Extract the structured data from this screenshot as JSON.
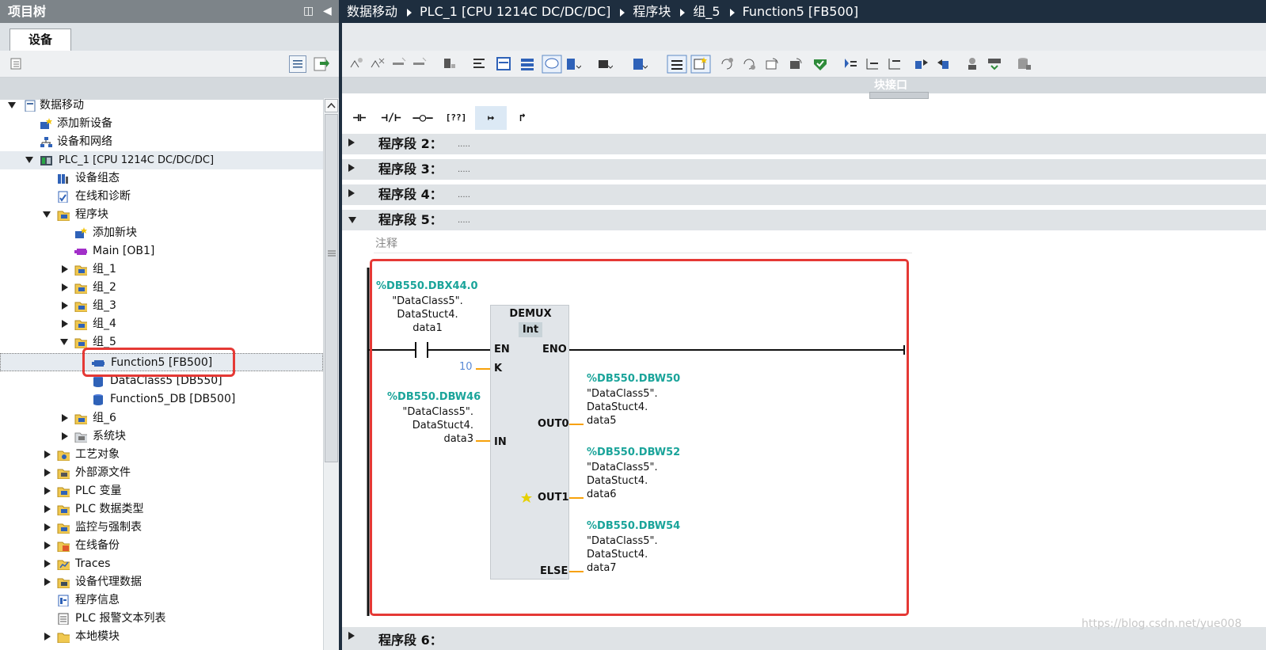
{
  "project_tree": {
    "title": "项目树",
    "tab": "设备",
    "items": [
      {
        "label": "数据移动"
      },
      {
        "label": "添加新设备"
      },
      {
        "label": "设备和网络"
      },
      {
        "label": "PLC_1 [CPU 1214C DC/DC/DC]"
      },
      {
        "label": "设备组态"
      },
      {
        "label": "在线和诊断"
      },
      {
        "label": "程序块"
      },
      {
        "label": "添加新块"
      },
      {
        "label": "Main [OB1]"
      },
      {
        "label": "组_1"
      },
      {
        "label": "组_2"
      },
      {
        "label": "组_3"
      },
      {
        "label": "组_4"
      },
      {
        "label": "组_5"
      },
      {
        "label": "Function5 [FB500]"
      },
      {
        "label": "DataClass5 [DB550]"
      },
      {
        "label": "Function5_DB [DB500]"
      },
      {
        "label": "组_6"
      },
      {
        "label": "系统块"
      },
      {
        "label": "工艺对象"
      },
      {
        "label": "外部源文件"
      },
      {
        "label": "PLC 变量"
      },
      {
        "label": "PLC 数据类型"
      },
      {
        "label": "监控与强制表"
      },
      {
        "label": "在线备份"
      },
      {
        "label": "Traces"
      },
      {
        "label": "设备代理数据"
      },
      {
        "label": "程序信息"
      },
      {
        "label": "PLC 报警文本列表"
      },
      {
        "label": "本地模块"
      }
    ]
  },
  "breadcrumb": [
    "数据移动",
    "PLC_1 [CPU 1214C DC/DC/DC]",
    "程序块",
    "组_5",
    "Function5 [FB500]"
  ],
  "editor": {
    "interface_label": "块接口",
    "ladder_tools": [
      "⊣⊢",
      "⊣/⊢",
      "–○–",
      "[??]",
      "↦",
      "↱"
    ],
    "segments": [
      {
        "title": "程序段 2：",
        "dots": "....."
      },
      {
        "title": "程序段 3：",
        "dots": "....."
      },
      {
        "title": "程序段 4：",
        "dots": "....."
      },
      {
        "title": "程序段 5：",
        "dots": "....."
      }
    ],
    "segment6_title": "程序段 6：",
    "comment_placeholder": "注释"
  },
  "network5": {
    "contact": {
      "address": "%DB550.DBX44.0",
      "symbol": [
        "\"DataClass5\".",
        "DataStuct4.",
        "data1"
      ]
    },
    "box": {
      "name": "DEMUX",
      "type": "Int",
      "pins": {
        "en": "EN",
        "eno": "ENO",
        "k": "K",
        "in": "IN",
        "out0": "OUT0",
        "out1": "OUT1",
        "else": "ELSE"
      }
    },
    "k_value": "10",
    "in_operand": {
      "address": "%DB550.DBW46",
      "symbol": [
        "\"DataClass5\".",
        "DataStuct4.",
        "data3"
      ]
    },
    "outputs": [
      {
        "address": "%DB550.DBW50",
        "symbol": [
          "\"DataClass5\".",
          "DataStuct4.",
          "data5"
        ]
      },
      {
        "address": "%DB550.DBW52",
        "symbol": [
          "\"DataClass5\".",
          "DataStuct4.",
          "data6"
        ]
      },
      {
        "address": "%DB550.DBW54",
        "symbol": [
          "\"DataClass5\".",
          "DataStuct4.",
          "data7"
        ]
      }
    ]
  },
  "watermark": "https://blog.csdn.net/yue008",
  "colors": {
    "operand_address": "#1aa49a",
    "wire_output": "#f7a10a",
    "highlight": "#e53935",
    "breadcrumb_bg": "#1e2e3f"
  }
}
